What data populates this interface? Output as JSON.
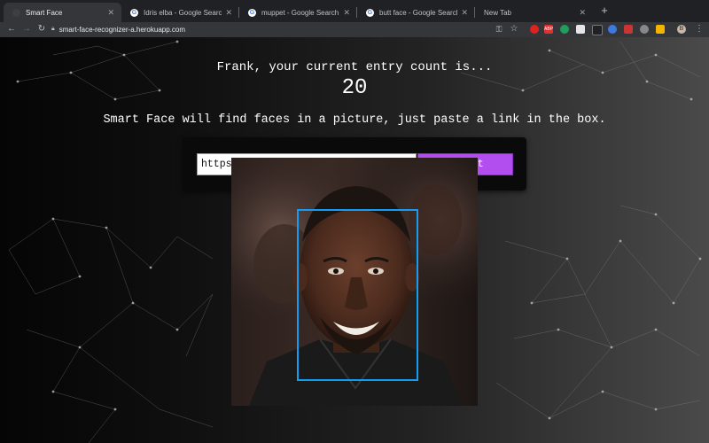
{
  "tabs": [
    {
      "label": "Smart Face",
      "icon": "smart-face-favicon",
      "active": true
    },
    {
      "label": "Idris elba - Google Search",
      "icon": "google-icon",
      "active": false
    },
    {
      "label": "muppet - Google Search",
      "icon": "google-icon",
      "active": false
    },
    {
      "label": "butt face - Google Search",
      "icon": "google-icon",
      "active": false
    },
    {
      "label": "New Tab",
      "icon": "",
      "active": false
    }
  ],
  "browser": {
    "url": "smart-face-recognizer-a.herokuapp.com",
    "accent_color": "#b24ef0",
    "face_box_color": "#149df2"
  },
  "page": {
    "greeting": "Frank, your current entry count is...",
    "entry_count": "20",
    "instructions": "Smart Face will find faces in a picture, just paste a link in the box.",
    "image_url_value": "https://www.biography.com/.image/ar_",
    "detect_label": "Detect"
  }
}
